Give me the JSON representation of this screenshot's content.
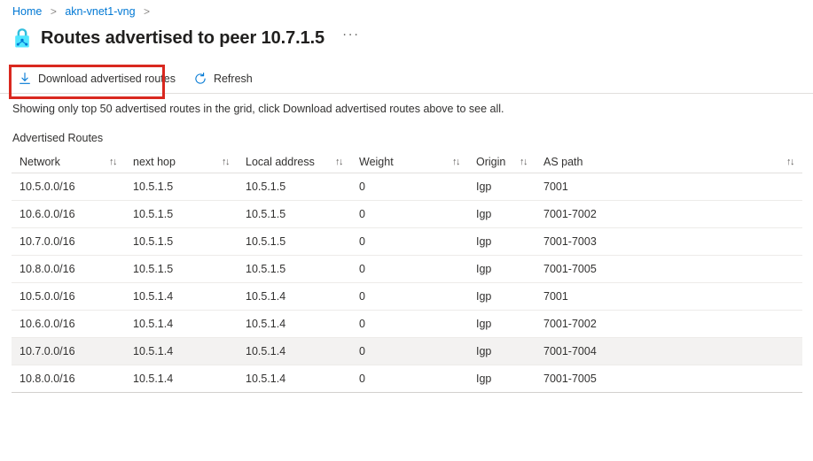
{
  "breadcrumb": {
    "items": [
      {
        "label": "Home"
      },
      {
        "label": "akn-vnet1-vng"
      }
    ],
    "separator": ">"
  },
  "header": {
    "icon": "vpn-gateway-lock-icon",
    "title": "Routes advertised to peer 10.7.1.5",
    "more_menu": "···"
  },
  "toolbar": {
    "download_label": "Download advertised routes",
    "download_icon": "download-icon",
    "refresh_label": "Refresh",
    "refresh_icon": "refresh-icon",
    "highlight_color": "#d9281f"
  },
  "note": "Showing only top 50 advertised routes in the grid, click Download advertised routes above to see all.",
  "section": {
    "label": "Advertised Routes"
  },
  "table": {
    "sort_icon": "↑↓",
    "columns": [
      {
        "label": "Network"
      },
      {
        "label": "next hop"
      },
      {
        "label": "Local address"
      },
      {
        "label": "Weight"
      },
      {
        "label": "Origin"
      },
      {
        "label": "AS path"
      }
    ],
    "rows": [
      {
        "network": "10.5.0.0/16",
        "next_hop": "10.5.1.5",
        "local_address": "10.5.1.5",
        "weight": "0",
        "origin": "Igp",
        "as_path": "7001",
        "highlighted": false
      },
      {
        "network": "10.6.0.0/16",
        "next_hop": "10.5.1.5",
        "local_address": "10.5.1.5",
        "weight": "0",
        "origin": "Igp",
        "as_path": "7001-7002",
        "highlighted": false
      },
      {
        "network": "10.7.0.0/16",
        "next_hop": "10.5.1.5",
        "local_address": "10.5.1.5",
        "weight": "0",
        "origin": "Igp",
        "as_path": "7001-7003",
        "highlighted": false
      },
      {
        "network": "10.8.0.0/16",
        "next_hop": "10.5.1.5",
        "local_address": "10.5.1.5",
        "weight": "0",
        "origin": "Igp",
        "as_path": "7001-7005",
        "highlighted": false
      },
      {
        "network": "10.5.0.0/16",
        "next_hop": "10.5.1.4",
        "local_address": "10.5.1.4",
        "weight": "0",
        "origin": "Igp",
        "as_path": "7001",
        "highlighted": false
      },
      {
        "network": "10.6.0.0/16",
        "next_hop": "10.5.1.4",
        "local_address": "10.5.1.4",
        "weight": "0",
        "origin": "Igp",
        "as_path": "7001-7002",
        "highlighted": false
      },
      {
        "network": "10.7.0.0/16",
        "next_hop": "10.5.1.4",
        "local_address": "10.5.1.4",
        "weight": "0",
        "origin": "Igp",
        "as_path": "7001-7004",
        "highlighted": true
      },
      {
        "network": "10.8.0.0/16",
        "next_hop": "10.5.1.4",
        "local_address": "10.5.1.4",
        "weight": "0",
        "origin": "Igp",
        "as_path": "7001-7005",
        "highlighted": false
      }
    ]
  },
  "colors": {
    "link": "#0078d4",
    "accent": "#0078d4",
    "text": "#323130",
    "annotation": "#d9281f",
    "row_selected": "#f3f2f1"
  }
}
